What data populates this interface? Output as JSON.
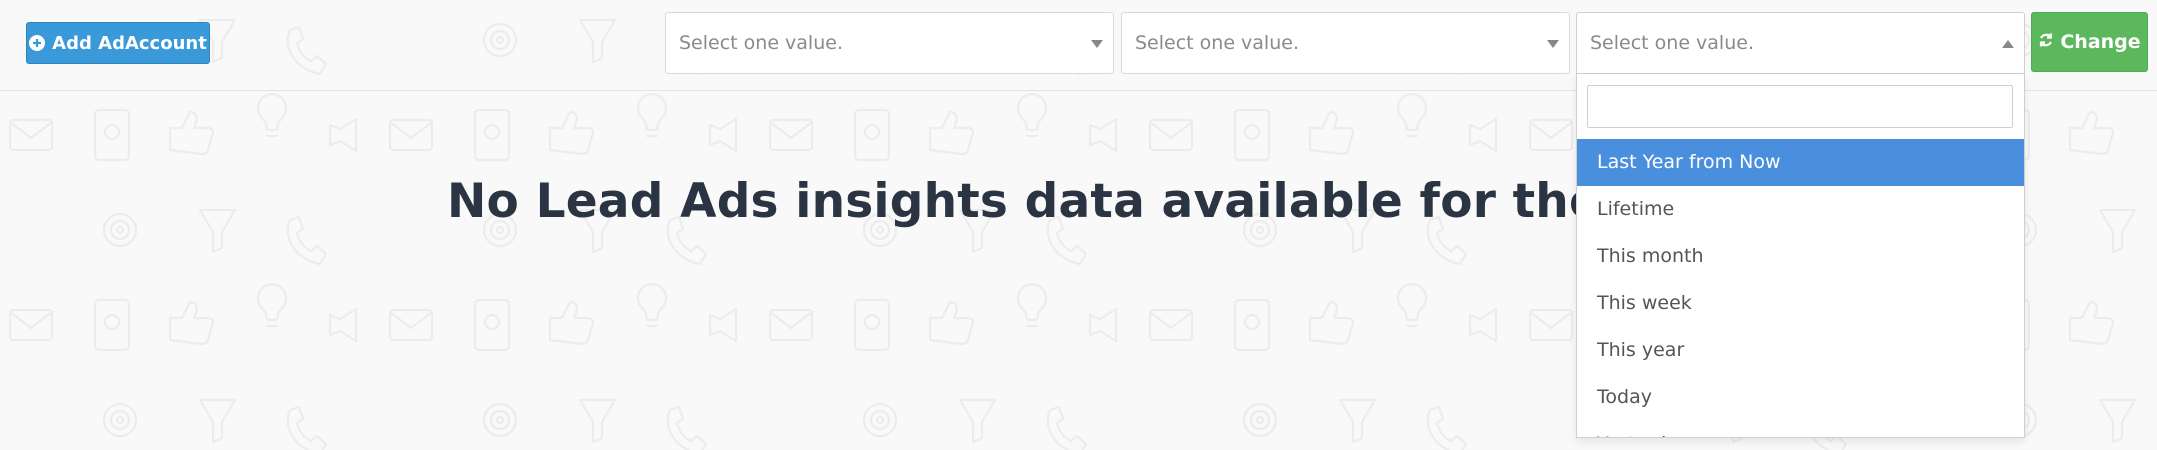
{
  "toolbar": {
    "add_button_label": "Add AdAccount",
    "select_1_placeholder": "Select one value.",
    "select_2_placeholder": "Select one value.",
    "select_3_placeholder": "Select one value.",
    "change_button_label": "Change"
  },
  "main": {
    "message": "No Lead Ads insights data available for the selected"
  },
  "dropdown": {
    "search_value": "",
    "options": [
      "Last Year from Now",
      "Lifetime",
      "This month",
      "This week",
      "This year",
      "Today",
      "Yesterday"
    ],
    "highlighted_index": 0
  },
  "colors": {
    "primary": "#3a9ad9",
    "success": "#5cb85c",
    "highlight": "#4a8fde"
  }
}
